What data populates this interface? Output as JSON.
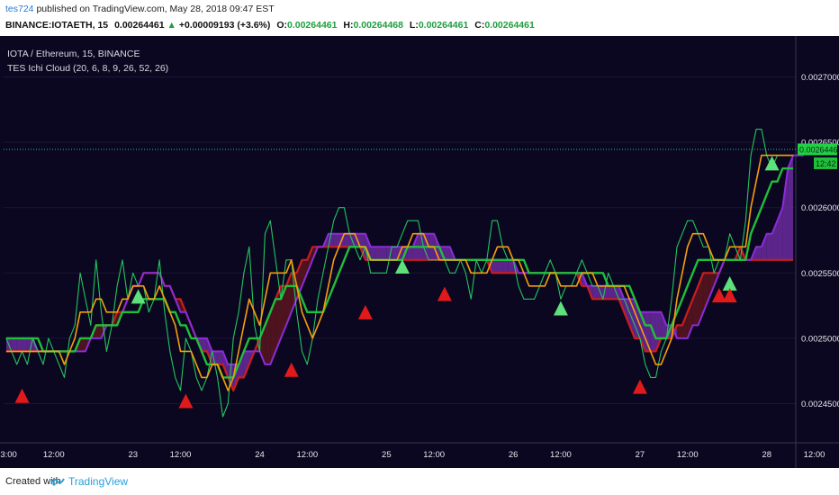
{
  "header": {
    "author": "tes724",
    "published_text": "published on TradingView.com, May 28, 2018 09:47 EST",
    "symbol": "BINANCE:IOTAETH, 15",
    "price": "0.00264461",
    "change": "+0.00009193 (+3.6%)",
    "o_label": "O:",
    "o": "0.00264461",
    "h_label": "H:",
    "h": "0.00264468",
    "l_label": "L:",
    "l": "0.00264461",
    "c_label": "C:",
    "c": "0.00264461"
  },
  "legend": {
    "title": "IOTA / Ethereum, 15, BINANCE",
    "indicator": "TES Ichi Cloud (20, 6, 8, 9, 26, 52, 26)"
  },
  "footer": {
    "created_with": "Created with",
    "brand": "TradingView"
  },
  "colors": {
    "background": "#0b0720",
    "price": "#22c55e",
    "fast": "#f59e0b",
    "slow": "#1fbf3a",
    "red_line": "#c81e1e",
    "purple_line": "#8b2cd8",
    "cloud_bull": "#6b2aa0",
    "cloud_bear": "#5a1520",
    "up_arrow": "#5ee07a",
    "down_arrow": "#e01a1a",
    "last_price_tag": "#22d046",
    "time_tag": "#1fbf3a"
  },
  "chart_data": {
    "type": "line",
    "title": "IOTA / Ethereum, 15, BINANCE",
    "ylim": [
      0.00242,
      0.00273
    ],
    "y_ticks": [
      "0.00245000",
      "0.00250000",
      "0.00255000",
      "0.00260000",
      "0.00265000",
      "0.00270000"
    ],
    "y_tick_values": [
      0.00245,
      0.0025,
      0.00255,
      0.0026,
      0.00265,
      0.0027
    ],
    "x_ticks": [
      "03:00",
      "12:00",
      "23",
      "12:00",
      "24",
      "12:00",
      "25",
      "12:00",
      "26",
      "12:00",
      "27",
      "12:00",
      "28",
      "12:00"
    ],
    "x_tick_index": [
      0,
      9,
      24,
      33,
      48,
      57,
      72,
      81,
      96,
      105,
      120,
      129,
      144,
      153
    ],
    "last_price": "0.00264461",
    "last_price_value": 0.00264461,
    "countdown": "12:42",
    "series": [
      {
        "name": "price",
        "values": [
          0.0025,
          0.00249,
          0.00248,
          0.00249,
          0.00248,
          0.0025,
          0.00249,
          0.00248,
          0.0025,
          0.00249,
          0.00248,
          0.00247,
          0.0025,
          0.00251,
          0.00255,
          0.00253,
          0.00251,
          0.00256,
          0.00252,
          0.00249,
          0.00251,
          0.00254,
          0.00256,
          0.00253,
          0.00255,
          0.00254,
          0.00254,
          0.00252,
          0.00253,
          0.00256,
          0.00252,
          0.00249,
          0.00247,
          0.00246,
          0.0025,
          0.00249,
          0.00247,
          0.00246,
          0.00247,
          0.00249,
          0.00247,
          0.00244,
          0.00245,
          0.0025,
          0.00252,
          0.00255,
          0.00257,
          0.00251,
          0.00249,
          0.00258,
          0.00259,
          0.00256,
          0.00253,
          0.00256,
          0.00256,
          0.00252,
          0.00249,
          0.00248,
          0.0025,
          0.00253,
          0.00255,
          0.00257,
          0.00259,
          0.0026,
          0.0026,
          0.00258,
          0.00257,
          0.00256,
          0.00257,
          0.00255,
          0.00255,
          0.00255,
          0.00255,
          0.00257,
          0.00257,
          0.00258,
          0.00259,
          0.00259,
          0.00259,
          0.00257,
          0.00256,
          0.00256,
          0.00256,
          0.00256,
          0.00255,
          0.00255,
          0.00256,
          0.00255,
          0.00253,
          0.00256,
          0.00255,
          0.00256,
          0.00259,
          0.00259,
          0.00257,
          0.00256,
          0.00256,
          0.00254,
          0.00253,
          0.00253,
          0.00253,
          0.00254,
          0.00255,
          0.00256,
          0.00255,
          0.00253,
          0.00254,
          0.00254,
          0.00255,
          0.00256,
          0.00255,
          0.00254,
          0.00254,
          0.00253,
          0.00255,
          0.00254,
          0.00253,
          0.00253,
          0.00252,
          0.00251,
          0.0025,
          0.00248,
          0.00247,
          0.00247,
          0.00249,
          0.0025,
          0.00253,
          0.00257,
          0.00258,
          0.00259,
          0.00259,
          0.00258,
          0.00257,
          0.00257,
          0.00255,
          0.00256,
          0.00256,
          0.00258,
          0.00257,
          0.00256,
          0.00259,
          0.00264,
          0.00266,
          0.00266,
          0.00264,
          0.00263,
          0.00264,
          0.00264,
          0.00264,
          0.00264
        ]
      },
      {
        "name": "fast-ma",
        "values": [
          0.00249,
          0.00249,
          0.00249,
          0.00249,
          0.00249,
          0.00249,
          0.00249,
          0.00249,
          0.00249,
          0.00249,
          0.00249,
          0.00248,
          0.00249,
          0.0025,
          0.00252,
          0.00252,
          0.00252,
          0.00253,
          0.00253,
          0.00252,
          0.00252,
          0.00252,
          0.00253,
          0.00253,
          0.00254,
          0.00254,
          0.00254,
          0.00253,
          0.00253,
          0.00254,
          0.00253,
          0.00252,
          0.00251,
          0.00249,
          0.00249,
          0.00249,
          0.00248,
          0.00247,
          0.00247,
          0.00248,
          0.00248,
          0.00247,
          0.00246,
          0.00247,
          0.00249,
          0.00251,
          0.00253,
          0.00252,
          0.00251,
          0.00253,
          0.00255,
          0.00255,
          0.00255,
          0.00255,
          0.00256,
          0.00254,
          0.00252,
          0.00251,
          0.0025,
          0.00251,
          0.00252,
          0.00254,
          0.00256,
          0.00257,
          0.00258,
          0.00258,
          0.00258,
          0.00257,
          0.00257,
          0.00256,
          0.00256,
          0.00256,
          0.00256,
          0.00256,
          0.00256,
          0.00257,
          0.00257,
          0.00258,
          0.00258,
          0.00258,
          0.00257,
          0.00257,
          0.00256,
          0.00256,
          0.00256,
          0.00256,
          0.00256,
          0.00256,
          0.00255,
          0.00255,
          0.00255,
          0.00255,
          0.00256,
          0.00257,
          0.00257,
          0.00257,
          0.00256,
          0.00256,
          0.00255,
          0.00254,
          0.00254,
          0.00254,
          0.00254,
          0.00255,
          0.00255,
          0.00254,
          0.00254,
          0.00254,
          0.00254,
          0.00255,
          0.00255,
          0.00255,
          0.00254,
          0.00254,
          0.00254,
          0.00254,
          0.00254,
          0.00254,
          0.00253,
          0.00252,
          0.00251,
          0.0025,
          0.00249,
          0.00248,
          0.00248,
          0.00249,
          0.0025,
          0.00253,
          0.00255,
          0.00257,
          0.00258,
          0.00258,
          0.00258,
          0.00257,
          0.00256,
          0.00256,
          0.00256,
          0.00257,
          0.00257,
          0.00257,
          0.00257,
          0.0026,
          0.00262,
          0.00264,
          0.00264,
          0.00264,
          0.00264,
          0.00264,
          0.00264,
          0.00264
        ]
      },
      {
        "name": "slow-ma",
        "values": [
          0.0025,
          0.0025,
          0.0025,
          0.0025,
          0.0025,
          0.0025,
          0.0025,
          0.00249,
          0.00249,
          0.00249,
          0.00249,
          0.00249,
          0.00249,
          0.00249,
          0.0025,
          0.0025,
          0.0025,
          0.00251,
          0.00251,
          0.00251,
          0.00251,
          0.00251,
          0.00252,
          0.00252,
          0.00252,
          0.00252,
          0.00253,
          0.00253,
          0.00253,
          0.00253,
          0.00253,
          0.00252,
          0.00252,
          0.00251,
          0.00251,
          0.0025,
          0.0025,
          0.00249,
          0.00248,
          0.00248,
          0.00248,
          0.00247,
          0.00247,
          0.00247,
          0.00248,
          0.00249,
          0.0025,
          0.0025,
          0.0025,
          0.00251,
          0.00252,
          0.00253,
          0.00253,
          0.00254,
          0.00254,
          0.00254,
          0.00253,
          0.00252,
          0.00252,
          0.00252,
          0.00252,
          0.00253,
          0.00254,
          0.00255,
          0.00256,
          0.00257,
          0.00257,
          0.00257,
          0.00257,
          0.00256,
          0.00256,
          0.00256,
          0.00256,
          0.00256,
          0.00256,
          0.00256,
          0.00257,
          0.00257,
          0.00257,
          0.00257,
          0.00257,
          0.00257,
          0.00257,
          0.00256,
          0.00256,
          0.00256,
          0.00256,
          0.00256,
          0.00256,
          0.00256,
          0.00256,
          0.00256,
          0.00256,
          0.00256,
          0.00256,
          0.00256,
          0.00256,
          0.00256,
          0.00256,
          0.00255,
          0.00255,
          0.00255,
          0.00255,
          0.00255,
          0.00255,
          0.00255,
          0.00255,
          0.00255,
          0.00255,
          0.00255,
          0.00255,
          0.00255,
          0.00255,
          0.00255,
          0.00254,
          0.00254,
          0.00254,
          0.00254,
          0.00254,
          0.00253,
          0.00252,
          0.00251,
          0.00251,
          0.0025,
          0.0025,
          0.0025,
          0.00251,
          0.00252,
          0.00253,
          0.00254,
          0.00255,
          0.00256,
          0.00256,
          0.00256,
          0.00256,
          0.00256,
          0.00256,
          0.00256,
          0.00256,
          0.00256,
          0.00256,
          0.00258,
          0.00259,
          0.0026,
          0.00261,
          0.00262,
          0.00262,
          0.00263,
          0.00263,
          0.00263
        ]
      },
      {
        "name": "red-line",
        "values": [
          0.00249,
          0.00249,
          0.00249,
          0.00249,
          0.00249,
          0.00249,
          0.00249,
          0.00249,
          0.00249,
          0.00249,
          0.00249,
          0.00249,
          0.00249,
          0.00249,
          0.0025,
          0.0025,
          0.0025,
          0.00251,
          0.00251,
          0.00251,
          0.00251,
          0.00252,
          0.00252,
          0.00253,
          0.00254,
          0.00254,
          0.00255,
          0.00255,
          0.00255,
          0.00255,
          0.00254,
          0.00254,
          0.00253,
          0.00253,
          0.00252,
          0.00251,
          0.0025,
          0.00249,
          0.00249,
          0.00248,
          0.00248,
          0.00248,
          0.00247,
          0.00246,
          0.00247,
          0.00247,
          0.00248,
          0.00249,
          0.0025,
          0.00251,
          0.00252,
          0.00253,
          0.00254,
          0.00254,
          0.00255,
          0.00255,
          0.00256,
          0.00256,
          0.00257,
          0.00257,
          0.00257,
          0.00257,
          0.00257,
          0.00257,
          0.00257,
          0.00257,
          0.00257,
          0.00257,
          0.00256,
          0.00256,
          0.00256,
          0.00256,
          0.00256,
          0.00256,
          0.00256,
          0.00256,
          0.00256,
          0.00256,
          0.00256,
          0.00256,
          0.00256,
          0.00256,
          0.00256,
          0.00256,
          0.00256,
          0.00256,
          0.00256,
          0.00256,
          0.00256,
          0.00256,
          0.00256,
          0.00256,
          0.00255,
          0.00255,
          0.00255,
          0.00255,
          0.00255,
          0.00255,
          0.00255,
          0.00255,
          0.00255,
          0.00255,
          0.00255,
          0.00255,
          0.00255,
          0.00255,
          0.00255,
          0.00255,
          0.00255,
          0.00254,
          0.00254,
          0.00253,
          0.00253,
          0.00253,
          0.00253,
          0.00253,
          0.00253,
          0.00252,
          0.00251,
          0.0025,
          0.0025,
          0.00249,
          0.00249,
          0.00249,
          0.0025,
          0.0025,
          0.0025,
          0.00251,
          0.00251,
          0.00252,
          0.00253,
          0.00254,
          0.00255,
          0.00255,
          0.00255,
          0.00255,
          0.00256,
          0.00256,
          0.00256,
          0.00257,
          0.00256,
          0.00256,
          0.00256,
          0.00256,
          0.00256,
          0.00256,
          0.00256,
          0.00256,
          0.00256,
          0.00256
        ]
      },
      {
        "name": "purple-line",
        "values": [
          0.0025,
          0.0025,
          0.0025,
          0.0025,
          0.0025,
          0.0025,
          0.00249,
          0.00249,
          0.00249,
          0.00249,
          0.00249,
          0.00249,
          0.00249,
          0.00249,
          0.00249,
          0.00249,
          0.0025,
          0.0025,
          0.0025,
          0.00251,
          0.00251,
          0.00251,
          0.00252,
          0.00253,
          0.00254,
          0.00254,
          0.00255,
          0.00255,
          0.00255,
          0.00255,
          0.00254,
          0.00254,
          0.00253,
          0.00252,
          0.00252,
          0.00251,
          0.0025,
          0.0025,
          0.0025,
          0.00249,
          0.00249,
          0.00249,
          0.00248,
          0.00248,
          0.00248,
          0.00249,
          0.00249,
          0.00249,
          0.00249,
          0.00248,
          0.00248,
          0.00249,
          0.0025,
          0.00251,
          0.00252,
          0.00253,
          0.00254,
          0.00255,
          0.00256,
          0.00257,
          0.00257,
          0.00258,
          0.00258,
          0.00258,
          0.00258,
          0.00258,
          0.00258,
          0.00258,
          0.00258,
          0.00257,
          0.00257,
          0.00257,
          0.00257,
          0.00257,
          0.00257,
          0.00257,
          0.00257,
          0.00257,
          0.00258,
          0.00258,
          0.00258,
          0.00258,
          0.00257,
          0.00257,
          0.00257,
          0.00256,
          0.00256,
          0.00256,
          0.00256,
          0.00256,
          0.00256,
          0.00256,
          0.00256,
          0.00256,
          0.00256,
          0.00256,
          0.00256,
          0.00255,
          0.00255,
          0.00255,
          0.00255,
          0.00255,
          0.00255,
          0.00255,
          0.00255,
          0.00255,
          0.00255,
          0.00255,
          0.00255,
          0.00255,
          0.00254,
          0.00254,
          0.00254,
          0.00254,
          0.00254,
          0.00254,
          0.00254,
          0.00253,
          0.00253,
          0.00253,
          0.00252,
          0.00252,
          0.00252,
          0.00252,
          0.00252,
          0.00251,
          0.00251,
          0.0025,
          0.0025,
          0.0025,
          0.00251,
          0.00251,
          0.00252,
          0.00253,
          0.00254,
          0.00255,
          0.00256,
          0.00256,
          0.00256,
          0.00256,
          0.00256,
          0.00256,
          0.00257,
          0.00257,
          0.00258,
          0.00258,
          0.00259,
          0.0026,
          0.00263,
          0.00264,
          0.00264,
          0.00264
        ]
      }
    ],
    "up_signals": [
      {
        "i": 25,
        "v": 0.002532
      },
      {
        "i": 75,
        "v": 0.002555
      },
      {
        "i": 105,
        "v": 0.002523
      },
      {
        "i": 137,
        "v": 0.002542
      },
      {
        "i": 145,
        "v": 0.002634
      }
    ],
    "down_signals": [
      {
        "i": 3,
        "v": 0.002456
      },
      {
        "i": 34,
        "v": 0.002452
      },
      {
        "i": 54,
        "v": 0.002476
      },
      {
        "i": 68,
        "v": 0.00252
      },
      {
        "i": 83,
        "v": 0.002534
      },
      {
        "i": 120,
        "v": 0.002463
      },
      {
        "i": 135,
        "v": 0.002533
      },
      {
        "i": 137,
        "v": 0.002533
      }
    ]
  }
}
